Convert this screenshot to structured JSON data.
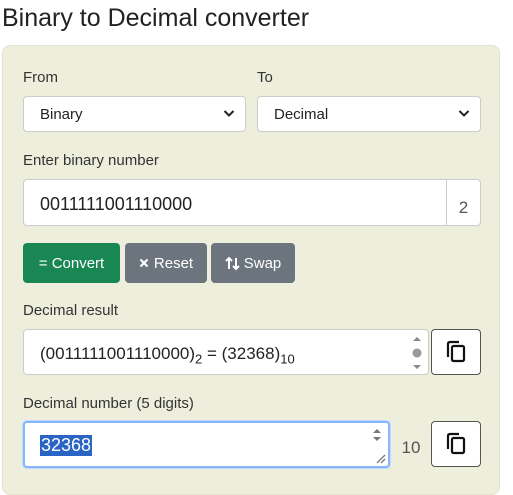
{
  "page": {
    "title": "Binary to Decimal converter"
  },
  "from": {
    "label": "From",
    "selected": "Binary"
  },
  "to": {
    "label": "To",
    "selected": "Decimal"
  },
  "input": {
    "label": "Enter binary number",
    "value": "0011111001110000",
    "base_addon": "2"
  },
  "buttons": {
    "convert": "= Convert",
    "reset": "Reset",
    "swap": "Swap"
  },
  "result": {
    "label": "Decimal result",
    "binary": "(0011111001110000)",
    "from_base": "2",
    "equals": " = ",
    "decimal": "(32368)",
    "to_base": "10"
  },
  "decimal_number": {
    "label": "Decimal number (5 digits)",
    "value": "32368",
    "base_addon": "10"
  },
  "colors": {
    "panel": "#eeeedd",
    "convert": "#198754",
    "secondary": "#6c757d",
    "selection": "#2a64c5",
    "focus": "#86b7fe"
  },
  "icons": {
    "reset": "x-icon",
    "swap": "swap-arrows-icon",
    "copy": "copy-icon"
  }
}
